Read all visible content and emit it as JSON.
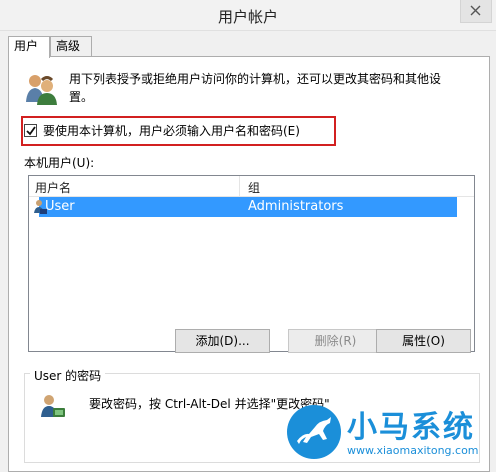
{
  "window": {
    "title": "用户帐户"
  },
  "tabs": [
    {
      "label": "用户",
      "active": true
    },
    {
      "label": "高级",
      "active": false
    }
  ],
  "intro_text": "用下列表授予或拒绝用户访问你的计算机，还可以更改其密码和其他设置。",
  "require_login": {
    "label": "要使用本计算机，用户必须输入用户名和密码(E)",
    "checked": true
  },
  "user_list": {
    "label": "本机用户(U):",
    "columns": [
      "用户名",
      "组"
    ],
    "rows": [
      {
        "name": "User",
        "group": "Administrators",
        "selected": true
      }
    ]
  },
  "buttons": {
    "add": "添加(D)...",
    "remove": "删除(R)",
    "properties": "属性(O)"
  },
  "password_group": {
    "legend": "User 的密码",
    "text": "要改密码，按 Ctrl-Alt-Del 并选择\"更改密码\""
  },
  "watermark": {
    "title": "小马系统",
    "url": "www.xiaomaxitong.com"
  },
  "colors": {
    "selection": "#3399ff",
    "highlight_border": "#d22020",
    "watermark": "#1b8fd9"
  }
}
